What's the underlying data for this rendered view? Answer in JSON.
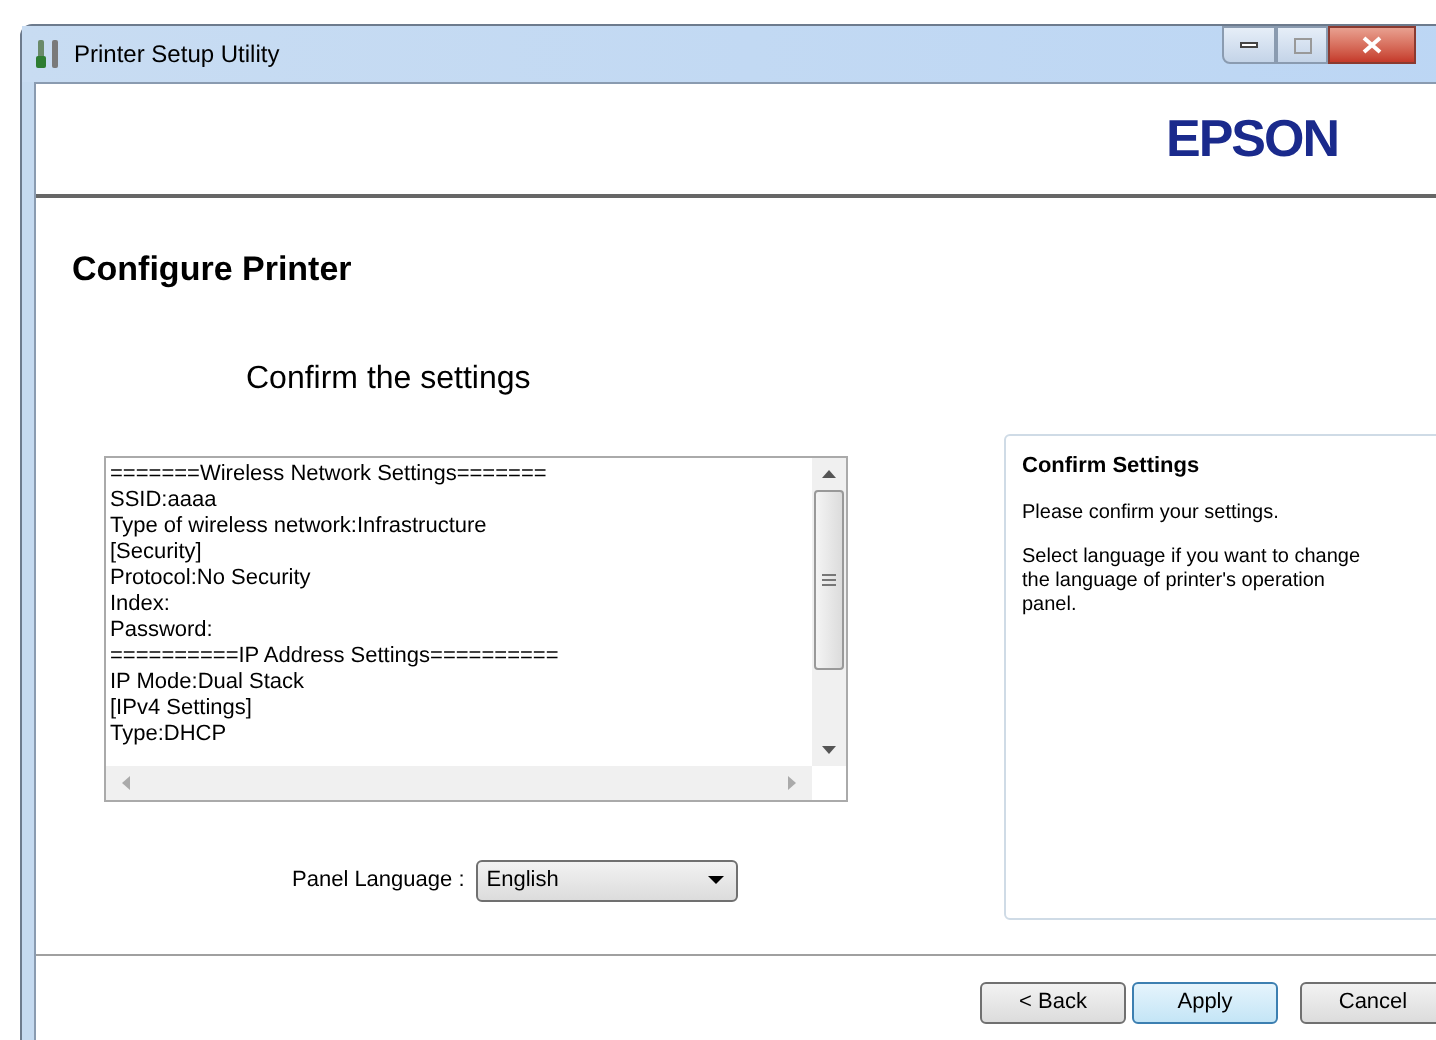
{
  "window": {
    "title": "Printer Setup Utility"
  },
  "header": {
    "logo": "EPSON"
  },
  "page": {
    "title": "Configure Printer",
    "subtitle": "Confirm the settings"
  },
  "settings_text": [
    "=======Wireless Network Settings=======",
    "SSID:aaaa",
    "Type of wireless network:Infrastructure",
    "[Security]",
    "Protocol:No Security",
    "Index:",
    "Password:",
    "==========IP Address Settings==========",
    "IP Mode:Dual Stack",
    "[IPv4 Settings]",
    "Type:DHCP"
  ],
  "help": {
    "title": "Confirm Settings",
    "paragraphs": [
      "Please confirm your settings.",
      "Select language if you want to change the language of printer's operation panel."
    ]
  },
  "panel_language": {
    "label": "Panel Language :",
    "value": "English"
  },
  "buttons": [
    {
      "label": "< Back",
      "default": false
    },
    {
      "label": "Apply",
      "default": true
    },
    {
      "label": "Cancel",
      "default": false
    }
  ]
}
